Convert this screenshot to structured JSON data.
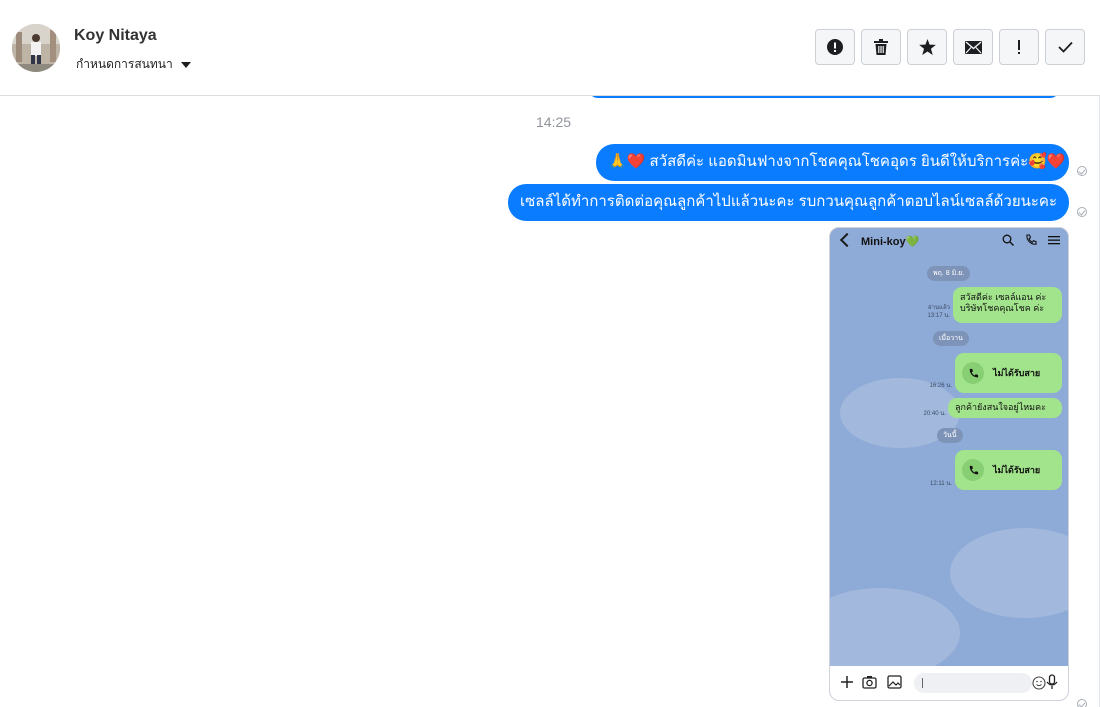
{
  "header": {
    "contact_name": "Koy Nitaya",
    "assign_label": "กำหนดการสนทนา",
    "actions": [
      {
        "name": "report-button",
        "icon": "exclamation-circle-icon"
      },
      {
        "name": "delete-button",
        "icon": "trash-icon"
      },
      {
        "name": "star-button",
        "icon": "star-icon"
      },
      {
        "name": "mark-unread-button",
        "icon": "envelope-icon"
      },
      {
        "name": "follow-up-button",
        "icon": "exclamation-icon"
      },
      {
        "name": "mark-done-button",
        "icon": "check-icon"
      }
    ]
  },
  "thread": {
    "timestamp": "14:25",
    "messages": [
      {
        "text": "🙏❤️ สวัสดีค่ะ แอดมินฟางจากโชคคุณโชคอุดร ยินดีให้บริการค่ะ🥰❤️",
        "sender": "page"
      },
      {
        "text": "เซลล์ได้ทำการติดต่อคุณลูกค้าไปแล้วนะคะ รบกวนคุณลูกค้าตอบไลน์เซลล์ด้วยนะคะ",
        "sender": "page"
      }
    ]
  },
  "screenshot": {
    "chat_title": "Mini-koy💚",
    "date1": "พฤ. 8 มิ.ย.",
    "msg1_line1": "สวัสดีค่ะ เซลล์แอน ค่ะ",
    "msg1_line2": "บริษัทโชคคุณโชค ค่ะ",
    "msg1_meta1": "อ่านแล้ว",
    "msg1_meta2": "13:17 น.",
    "date2": "เมื่อวาน",
    "call1_label": "ไม่ได้รับสาย",
    "call1_time": "16:26 น.",
    "msg2": "ลูกค้ายังสนใจอยู่ไหมคะ",
    "msg2_time": "20:40 น.",
    "date3": "วันนี้",
    "call2_label": "ไม่ได้รับสาย",
    "call2_time": "12:11 น."
  },
  "colors": {
    "bubble": "#0a7cff",
    "line_bubble": "#a2e48c",
    "line_bg": "#8eaad6"
  }
}
